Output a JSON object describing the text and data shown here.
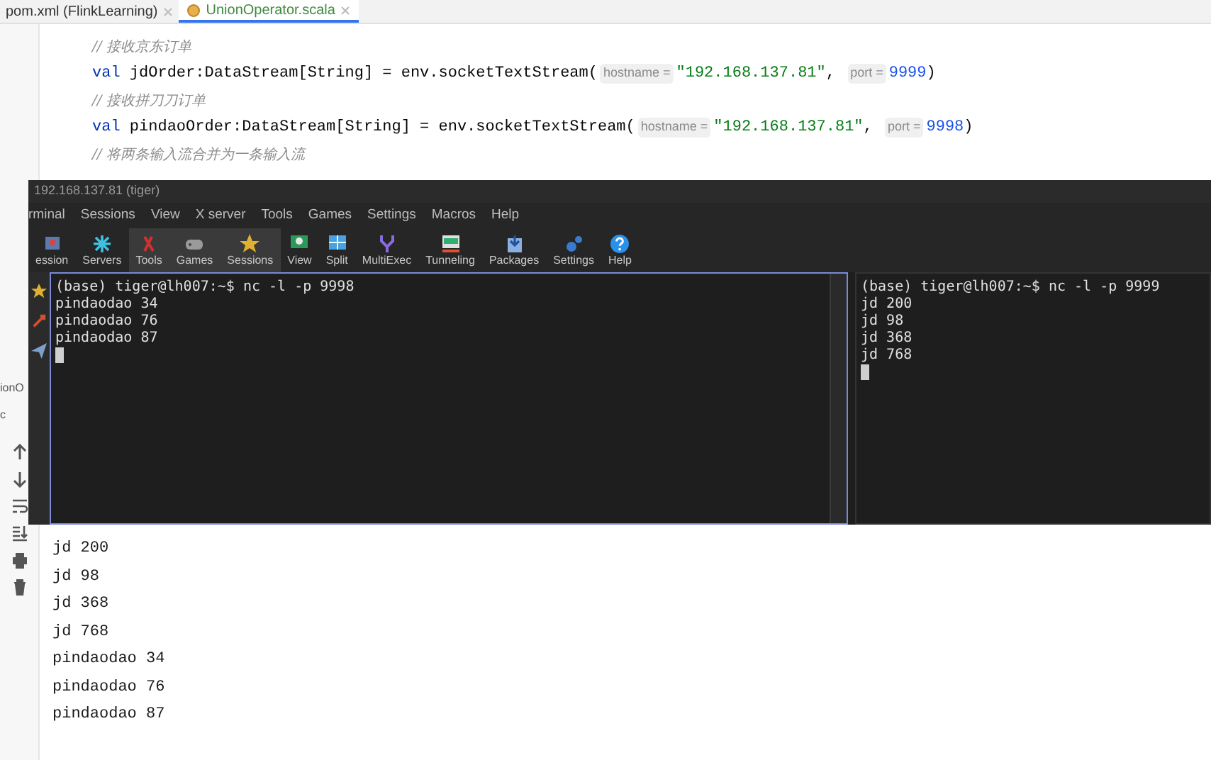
{
  "editor_tabs": [
    {
      "label": "pom.xml (FlinkLearning)",
      "selected": false
    },
    {
      "label": "UnionOperator.scala",
      "selected": true
    }
  ],
  "code_lines": [
    {
      "tokens": [
        {
          "kind": "comment",
          "text": "// 接收京东订单"
        }
      ]
    },
    {
      "tokens": [
        {
          "kind": "keyword",
          "text": "val"
        },
        {
          "kind": "plain",
          "text": " jdOrder:DataStream[String] = env.socketTextStream("
        },
        {
          "kind": "hint",
          "text": "hostname ="
        },
        {
          "kind": "string",
          "text": "\"192.168.137.81\""
        },
        {
          "kind": "plain",
          "text": ", "
        },
        {
          "kind": "hint",
          "text": "port ="
        },
        {
          "kind": "number",
          "text": "9999"
        },
        {
          "kind": "plain",
          "text": ")"
        }
      ]
    },
    {
      "tokens": [
        {
          "kind": "comment",
          "text": "// 接收拼刀刀订单"
        }
      ]
    },
    {
      "tokens": [
        {
          "kind": "keyword",
          "text": "val"
        },
        {
          "kind": "plain",
          "text": " pindaoOrder:DataStream[String] = env.socketTextStream("
        },
        {
          "kind": "hint",
          "text": "hostname ="
        },
        {
          "kind": "string",
          "text": "\"192.168.137.81\""
        },
        {
          "kind": "plain",
          "text": ", "
        },
        {
          "kind": "hint",
          "text": "port ="
        },
        {
          "kind": "number",
          "text": "9998"
        },
        {
          "kind": "plain",
          "text": ")"
        }
      ]
    },
    {
      "tokens": [
        {
          "kind": "comment",
          "text": "// 将两条输入流合并为一条输入流"
        }
      ]
    }
  ],
  "side_labels": [
    "ionO",
    "c"
  ],
  "terminal": {
    "title": "192.168.137.81 (tiger)",
    "menu": [
      "rminal",
      "Sessions",
      "View",
      "X server",
      "Tools",
      "Games",
      "Settings",
      "Macros",
      "Help"
    ],
    "toolbar": [
      {
        "label": "ession",
        "highlighted": false
      },
      {
        "label": "Servers",
        "highlighted": false
      },
      {
        "label": "Tools",
        "highlighted": true
      },
      {
        "label": "Games",
        "highlighted": true
      },
      {
        "label": "Sessions",
        "highlighted": true
      },
      {
        "label": "View",
        "highlighted": false
      },
      {
        "label": "Split",
        "highlighted": false
      },
      {
        "label": "MultiExec",
        "highlighted": false
      },
      {
        "label": "Tunneling",
        "highlighted": false
      },
      {
        "label": "Packages",
        "highlighted": false
      },
      {
        "label": "Settings",
        "highlighted": false
      },
      {
        "label": "Help",
        "highlighted": false
      }
    ],
    "panes": [
      {
        "focused": true,
        "lines": [
          "(base) tiger@lh007:~$ nc -l -p 9998",
          "pindaodao 34",
          "pindaodao 76",
          "pindaodao 87"
        ]
      },
      {
        "focused": false,
        "lines": [
          "(base) tiger@lh007:~$ nc -l -p 9999",
          "jd 200",
          "jd 98",
          "jd 368",
          "jd 768"
        ]
      }
    ]
  },
  "console": {
    "lines": [
      "jd 200",
      "jd 98",
      "jd 368",
      "jd 768",
      "pindaodao 34",
      "pindaodao 76",
      "pindaodao 87"
    ]
  }
}
